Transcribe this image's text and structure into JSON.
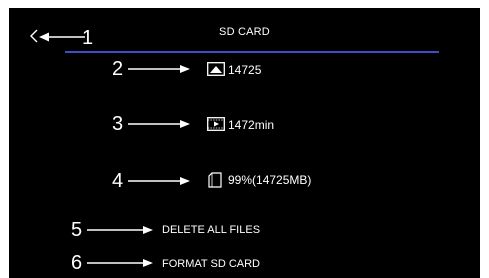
{
  "header": {
    "title": "SD CARD",
    "back_icon": "chevron-left-icon",
    "divider_color": "#3b50c8"
  },
  "callouts": [
    "1",
    "2",
    "3",
    "4",
    "5",
    "6"
  ],
  "info": {
    "photo_count": {
      "icon": "photo-icon",
      "value": "14725"
    },
    "video_time": {
      "icon": "video-icon",
      "value": "1472min"
    },
    "storage": {
      "icon": "sd-card-icon",
      "value": "99%(14725MB)"
    }
  },
  "menu": {
    "delete_all": "DELETE ALL FILES",
    "format": "FORMAT SD CARD"
  },
  "colors": {
    "background": "#000000",
    "text": "#ffffff",
    "accent": "#3b50c8"
  }
}
